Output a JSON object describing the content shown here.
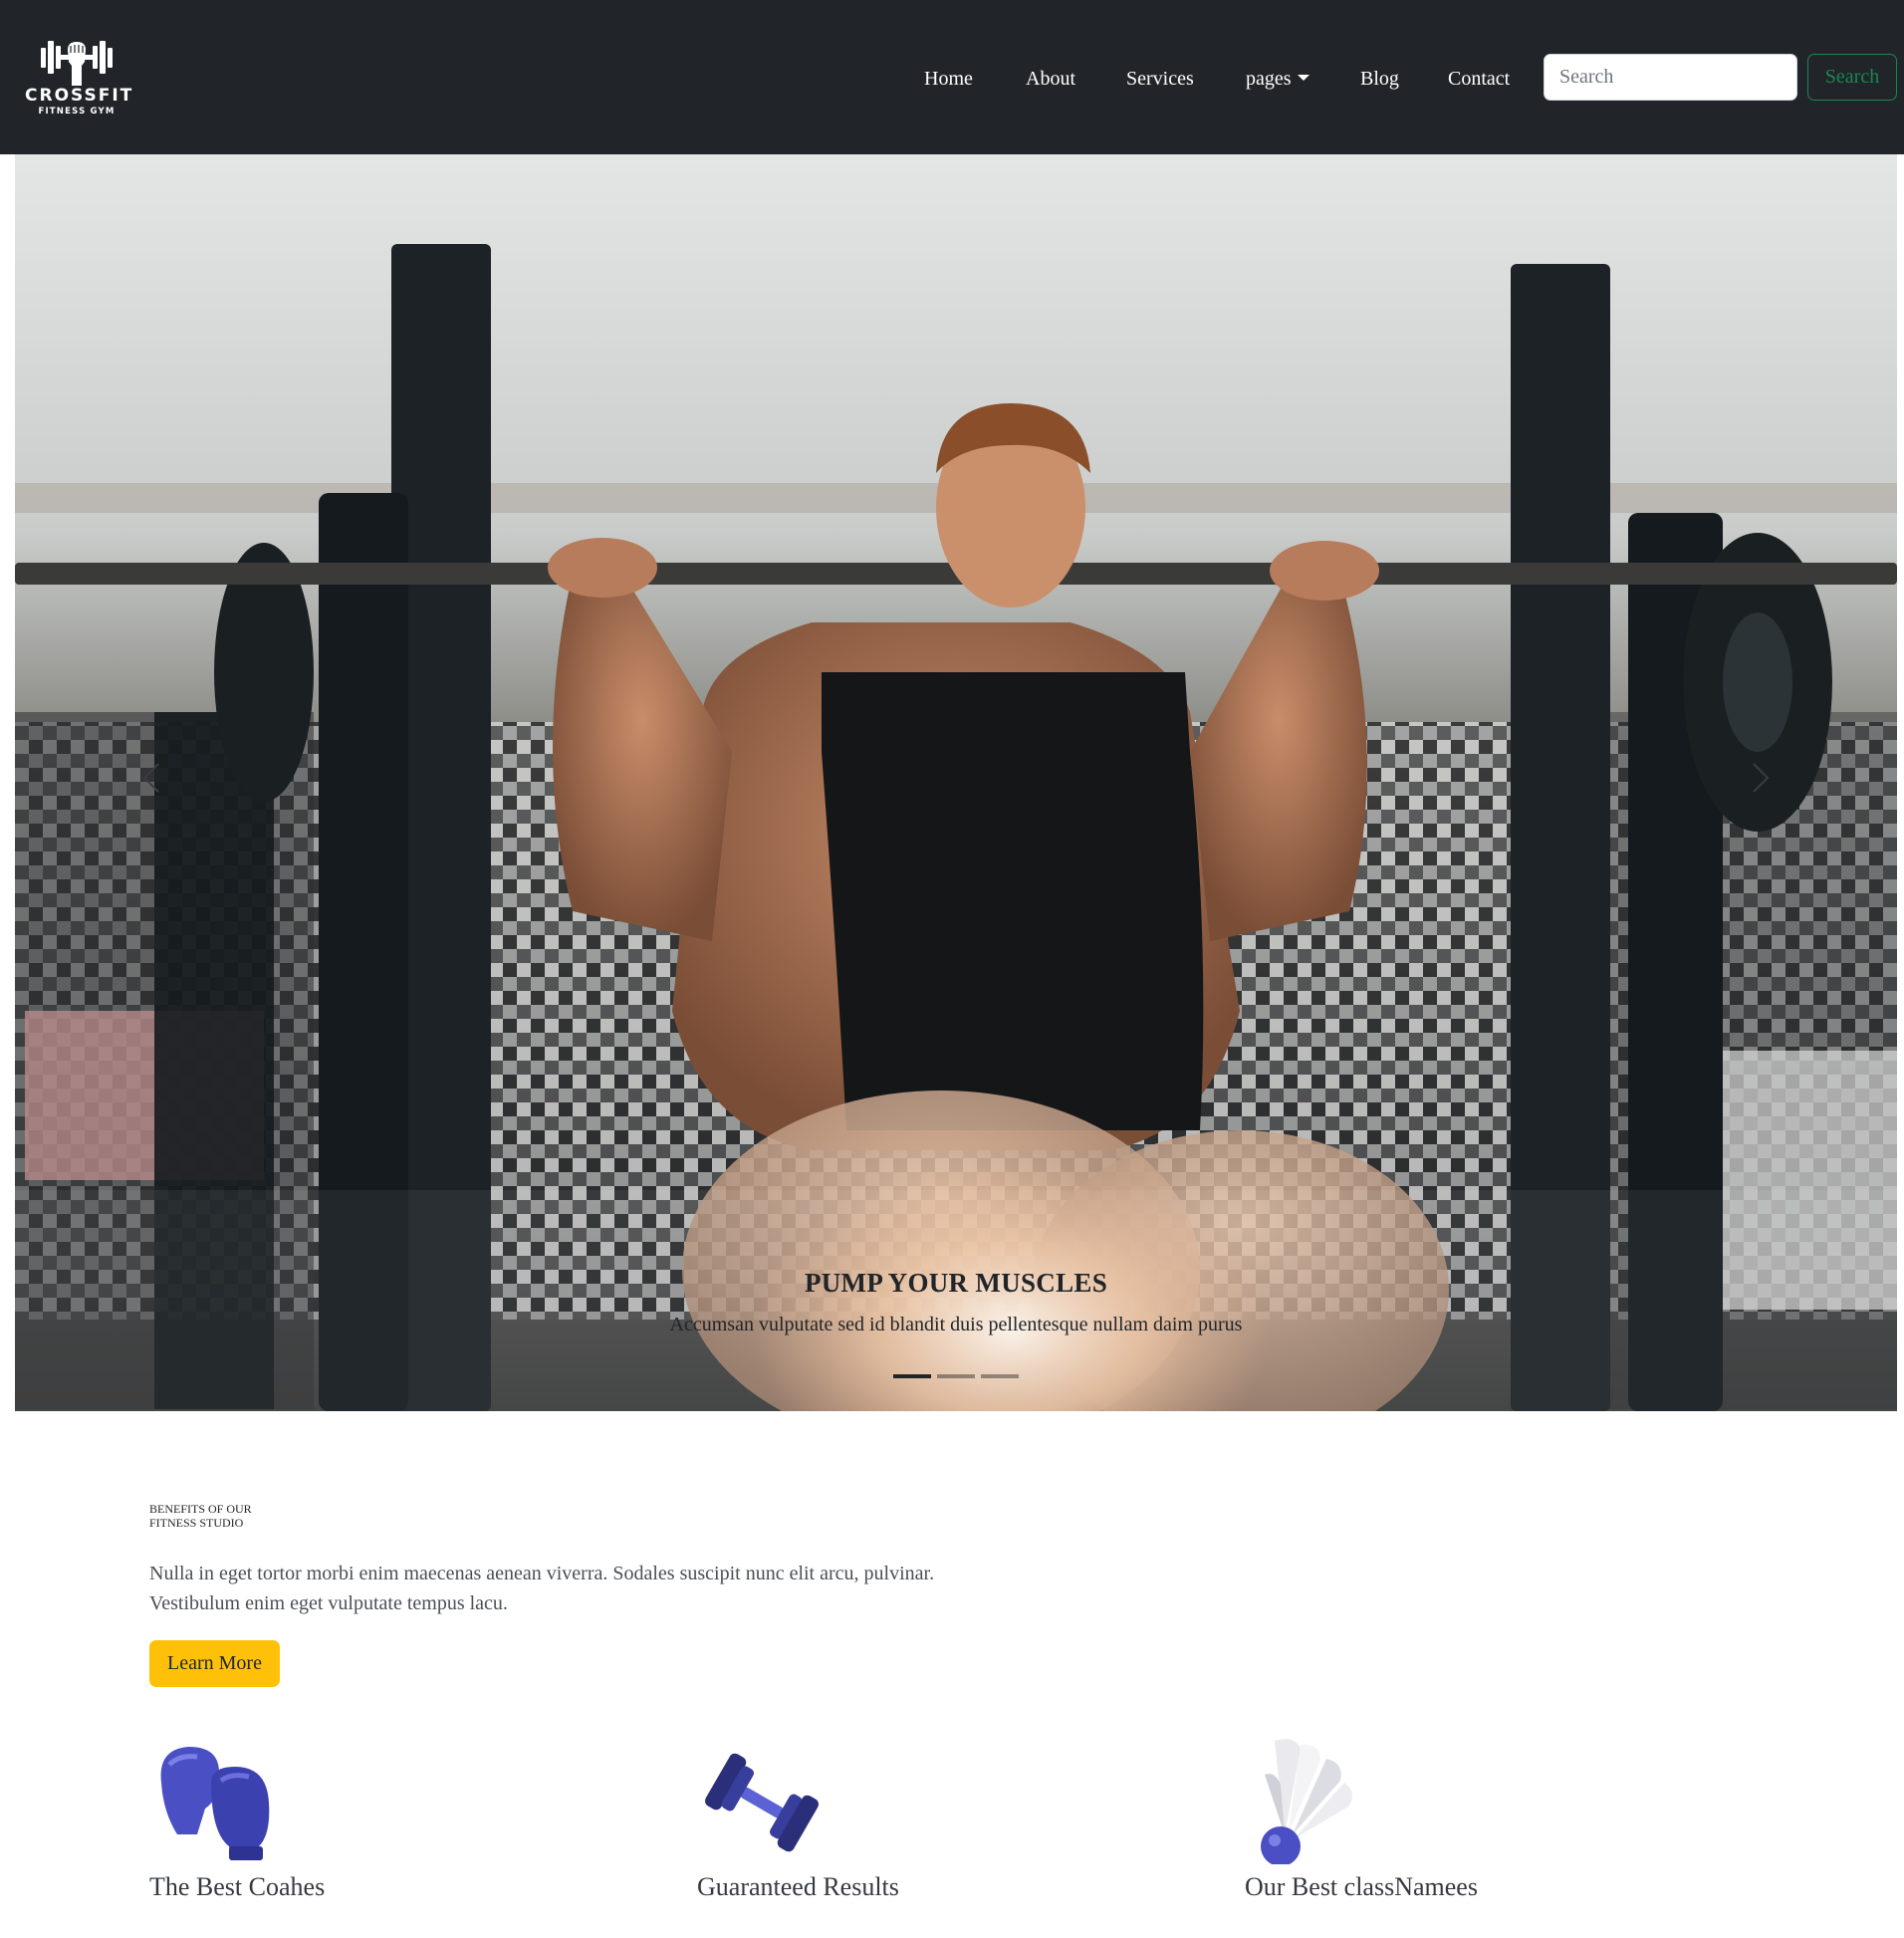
{
  "brand": {
    "name": "CROSSFIT",
    "tagline": "FITNESS GYM"
  },
  "nav": {
    "items": [
      {
        "label": "Home"
      },
      {
        "label": "About"
      },
      {
        "label": "Services"
      },
      {
        "label": "pages"
      },
      {
        "label": "Blog"
      },
      {
        "label": "Contact"
      }
    ],
    "search_placeholder": "Search",
    "search_button": "Search"
  },
  "hero": {
    "title": "PUMP YOUR MUSCLES",
    "text": "Accumsan vulputate sed id blandit duis pellentesque nullam daim purus",
    "slide_count": 3,
    "active_slide": 1
  },
  "benefits": {
    "label_line1": "BENEFITS OF OUR",
    "label_line2": "FITNESS STUDIO",
    "text": "Nulla in eget tortor morbi enim maecenas aenean viverra. Sodales suscipit nunc elit arcu, pulvinar. Vestibulum enim eget vulputate tempus lacu.",
    "button": "Learn More"
  },
  "features": [
    {
      "title": "The Best Coahes",
      "icon": "boxing-gloves-icon"
    },
    {
      "title": "Guaranteed Results",
      "icon": "dumbbell-icon"
    },
    {
      "title": "Our Best classNamees",
      "icon": "shuttlecock-icon"
    }
  ],
  "colors": {
    "navbar": "#212529",
    "search_button": "#198754",
    "learn_more": "#ffc107",
    "icon_accent": "#4a4fc4"
  }
}
